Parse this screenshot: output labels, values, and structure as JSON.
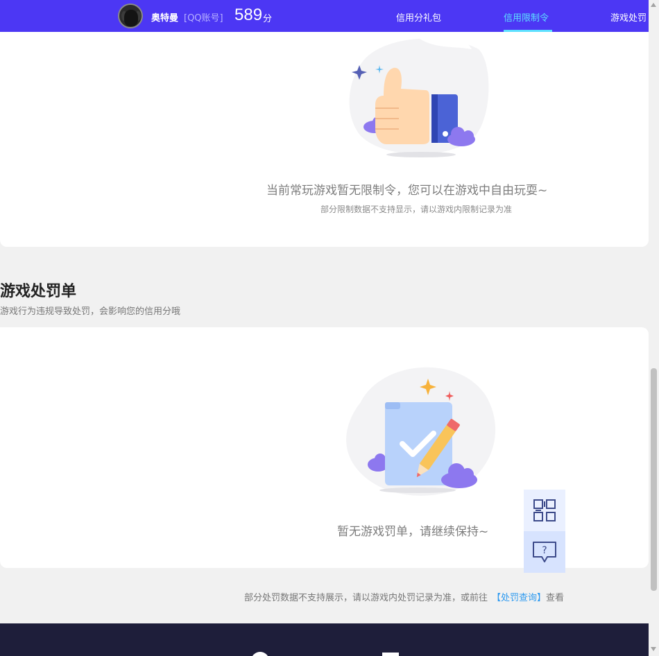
{
  "header": {
    "username": "奥特曼",
    "account_type": "[QQ账号]",
    "score": "589",
    "score_unit": "分",
    "nav": [
      {
        "label": "信用分礼包",
        "active": false
      },
      {
        "label": "信用限制令",
        "active": true
      },
      {
        "label": "游戏处罚"
      }
    ],
    "accent_color": "#4c37f4",
    "active_color": "#5de0ff"
  },
  "restriction_card": {
    "empty_title": "当前常玩游戏暂无限制令，您可以在游戏中自由玩耍~",
    "empty_note": "部分限制数据不支持显示，请以游戏内限制记录为准",
    "illustration": "thumbs-up-illustration"
  },
  "penalty_section": {
    "title": "游戏处罚单",
    "description": "游戏行为违规导致处罚，会影响您的信用分哦",
    "empty_title": "暂无游戏罚单，请继续保持~",
    "illustration": "clipboard-pencil-illustration"
  },
  "footnote": {
    "text": "部分处罚数据不支持展示，请以游戏内处罚记录为准，或前往",
    "link": "【处罚查询】",
    "suffix": "查看"
  },
  "float_tools": [
    {
      "icon": "qr-code-icon"
    },
    {
      "icon": "help-chat-icon"
    }
  ]
}
